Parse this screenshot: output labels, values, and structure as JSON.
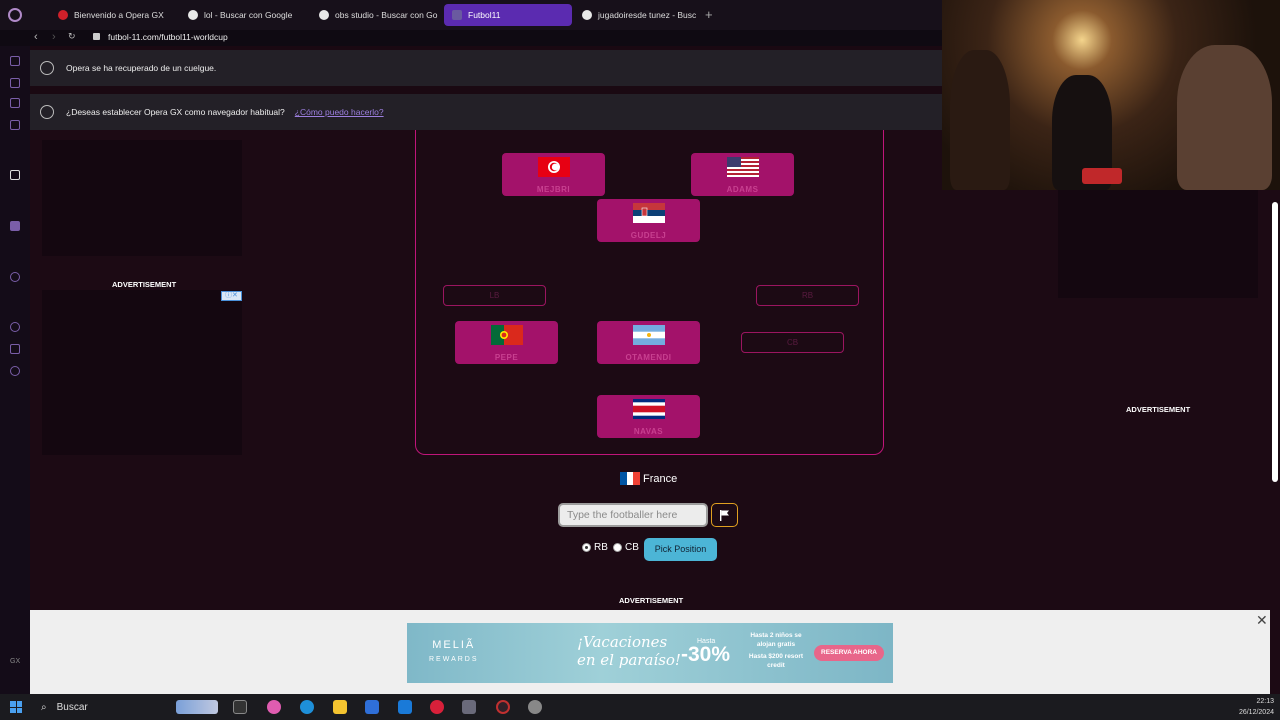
{
  "browser": {
    "tabs": [
      {
        "label": "Bienvenido a Opera GX",
        "favicon_color": "#d0202a"
      },
      {
        "label": "lol - Buscar con Google",
        "favicon_color": "#e8e8e8"
      },
      {
        "label": "obs studio - Buscar con Go",
        "favicon_color": "#e8e8e8"
      },
      {
        "label": "Futbol11",
        "favicon_color": "#6a5aa0"
      },
      {
        "label": "jugadoiresde tunez - Busc",
        "favicon_color": "#e8e8e8"
      }
    ],
    "url": "futbol-11.com/futbol11-worldcup",
    "notifications": [
      {
        "text": "Opera se ha recuperado de un cuelgue."
      },
      {
        "text": "¿Deseas establecer Opera GX como navegador habitual?",
        "link": "¿Cómo puedo hacerlo?"
      }
    ]
  },
  "ads": {
    "left_label": "ADVERTISEMENT",
    "right_label": "ADVERTISEMENT",
    "bottom_label": "ADVERTISEMENT"
  },
  "pitch": {
    "players": [
      {
        "name": "MEJBRI",
        "country": "Tunisia"
      },
      {
        "name": "ADAMS",
        "country": "USA"
      },
      {
        "name": "GUDELJ",
        "country": "Serbia"
      },
      {
        "name": "PEPE",
        "country": "Portugal"
      },
      {
        "name": "OTAMENDI",
        "country": "Argentina"
      },
      {
        "name": "NAVAS",
        "country": "Costa Rica"
      }
    ],
    "empty_slots": [
      "LB",
      "RB",
      "CB"
    ]
  },
  "game": {
    "current_country": "France",
    "input_placeholder": "Type the footballer here",
    "position_options": [
      "RB",
      "CB"
    ],
    "selected_position": "RB",
    "pick_button": "Pick Position"
  },
  "banner": {
    "brand": "MELIÃ",
    "brand_sub": "REWARDS",
    "headline_1": "¡Vacaciones",
    "headline_2": "en el paraíso!",
    "discount_label": "Hasta",
    "discount": "-30%",
    "info_1": "Hasta 2 niños se alojan gratis",
    "info_2": "Hasta $200 resort credit",
    "cta": "RESERVA AHORA"
  },
  "taskbar": {
    "search": "Buscar",
    "time": "22:13",
    "date": "26/12/2024"
  },
  "sidebar": {
    "gx_label": "GX"
  }
}
